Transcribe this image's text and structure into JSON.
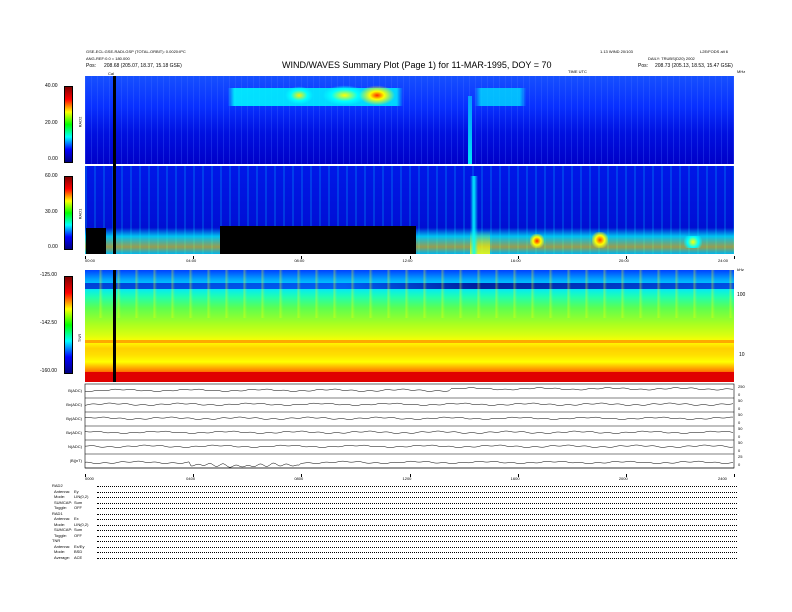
{
  "header": {
    "title": "WIND/WAVES Summary Plot (Page 1) for 11-MAR-1995, DOY = 70",
    "left_line1": "GSE-ECL:GSE-RADI-GSP (TOTAL-ORBIT): 0.0020:IPC",
    "left_line2": "ANG-REF:0.0 = 180.000",
    "left_line3_label": "Pos:",
    "left_line3_value": "208.68 (205.07, 18.37, 15.18 GSE)",
    "right_line1": "1.13 WIND 20/103",
    "right_line2": "DAILY: TRUBS(D20) 2002",
    "right_line3_label": "Pos:",
    "right_line3_value": "208.73 (205.13, 18.53, 15.47 GSE)",
    "far_right": "L2E/FODS alt 6",
    "time_label": "TIME UTC",
    "cal_label": "Cal"
  },
  "panels": {
    "rad2_label": "RAD2",
    "rad1_label": "RAD1",
    "tnr_label": "TNR",
    "rad2_ticks": [
      "40.00",
      "20.00",
      "0.00"
    ],
    "rad1_ticks": [
      "60.00",
      "30.00",
      "0.00"
    ],
    "tnr_ticks": [
      "-125.00",
      "-142.50",
      "-160.00"
    ],
    "tnr_right_ticks": [
      "100",
      "10"
    ],
    "time_ticks": [
      "00:00",
      "04:00",
      "08:00",
      "12:00",
      "16:00",
      "20:00",
      "24:00"
    ],
    "tnr_right_header": "kHz",
    "rad_right_header": "MHz",
    "bottom_time_ticks": [
      "0000",
      "0400",
      "0800",
      "1200",
      "1600",
      "2000",
      "2400"
    ],
    "trace_labels": [
      "B(ADC)",
      "Bx(ADC)",
      "By(ADC)",
      "Bz(ADC)",
      "N(ADC)",
      "|B|(nT)"
    ],
    "trace_right_ticks": [
      [
        "250",
        "0"
      ],
      [
        "50",
        "0"
      ],
      [
        "50",
        "0"
      ],
      [
        "50",
        "0"
      ],
      [
        "50",
        "0"
      ],
      [
        "25",
        "0"
      ]
    ]
  },
  "footer": {
    "sections": [
      {
        "name": "RAD2",
        "rows": [
          [
            "Antenna:",
            "Ey"
          ],
          [
            "Mode:",
            "LIN(0,2)"
          ],
          [
            "SUMCAP:",
            "Sum"
          ],
          [
            "Toggle:",
            "OFF"
          ]
        ]
      },
      {
        "name": "RAD1",
        "rows": [
          [
            "Antenna:",
            "Ex"
          ],
          [
            "Mode:",
            "LIN(0,2)"
          ],
          [
            "SUMCAP:",
            "Sum"
          ],
          [
            "Toggle:",
            "OFF"
          ]
        ]
      },
      {
        "name": "TNR",
        "rows": [
          [
            "Antenna:",
            "Ex/Ey"
          ],
          [
            "Mode:",
            "BSD"
          ],
          [
            "Average:",
            "ACE"
          ]
        ]
      }
    ]
  },
  "chart_data": [
    {
      "type": "heatmap",
      "name": "RAD2 dynamic spectrum",
      "ylabel": "RAD2",
      "ylim": [
        0,
        40
      ],
      "ytick_labels": [
        "40.00",
        "20.00",
        "0.00"
      ],
      "xtick_labels": [
        "00:00",
        "04:00",
        "08:00",
        "12:00",
        "16:00",
        "20:00",
        "24:00"
      ],
      "features": [
        {
          "start_hr": 5.1,
          "end_hr": 11.5,
          "description": "intense band"
        },
        {
          "start_hr": 14.0,
          "end_hr": 15.8,
          "description": "band"
        },
        {
          "start_hr": 19.5,
          "end_hr": 20.3,
          "description": "weak patch"
        }
      ],
      "grid": false
    },
    {
      "type": "heatmap",
      "name": "RAD1 dynamic spectrum",
      "ylabel": "RAD1",
      "ylim": [
        0,
        60
      ],
      "ytick_labels": [
        "60.00",
        "30.00",
        "0.00"
      ],
      "xtick_labels": [
        "00:00",
        "04:00",
        "08:00",
        "12:00",
        "16:00",
        "20:00",
        "24:00"
      ],
      "data_gap_hr": [
        5.0,
        12.3
      ],
      "features": [
        {
          "hour": 1.5,
          "description": "burst"
        },
        {
          "hour": 14.4,
          "description": "type III burst"
        },
        {
          "hour": 17.5,
          "description": "burst"
        },
        {
          "hour": 19.2,
          "description": "burst"
        },
        {
          "hour": 22.7,
          "description": "burst"
        }
      ],
      "grid": false
    },
    {
      "type": "heatmap",
      "name": "TNR dynamic spectrum",
      "ylabel": "TNR",
      "ylim": [
        -160,
        -125
      ],
      "ytick_labels": [
        "-125.00",
        "-142.50",
        "-160.00"
      ],
      "right_axis_labels": [
        "100",
        "10"
      ],
      "grid": false
    },
    {
      "type": "line",
      "name": "B traces",
      "xtick_labels": [
        "0000",
        "0400",
        "0800",
        "1200",
        "1600",
        "2000",
        "2400"
      ],
      "series_labels": [
        "B(ADC)",
        "Bx(ADC)",
        "By(ADC)",
        "Bz(ADC)",
        "N(ADC)",
        "|B|(nT)"
      ]
    }
  ],
  "colors": {
    "colorbar": [
      "#000080",
      "#0000ff",
      "#00ffff",
      "#00ff00",
      "#ffff00",
      "#ff0000",
      "#800000"
    ]
  }
}
